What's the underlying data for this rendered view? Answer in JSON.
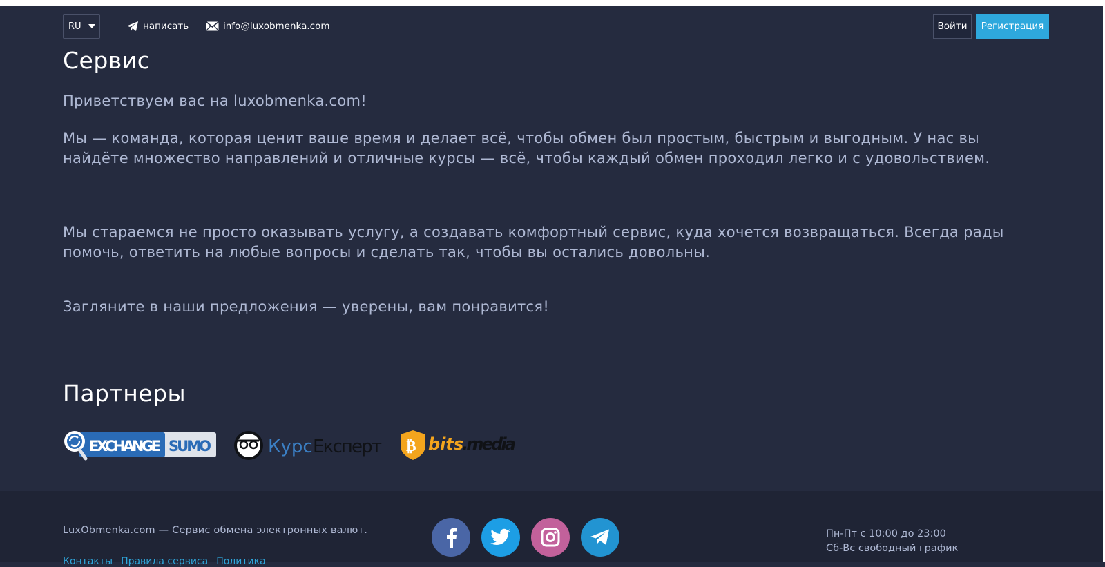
{
  "header": {
    "language": "RU",
    "write_label": "написать",
    "email": "info@luxobmenka.com",
    "login_label": "Войти",
    "register_label": "Регистрация"
  },
  "service": {
    "title": "Сервис",
    "paragraphs": [
      "Приветствуем вас на luxobmenka.com!",
      "Мы — команда, которая ценит ваше время и делает всё, чтобы обмен был простым, быстрым и выгодным. У нас вы найдёте множество направлений и отличные курсы — всё, чтобы каждый обмен проходил легко и с удовольствием.",
      "Мы стараемся не просто оказывать услугу, а создавать комфортный сервис, куда хочется возвращаться. Всегда рады помочь, ответить на любые вопросы и сделать так, чтобы вы остались довольны.",
      "Загляните в наши предложения — уверены, вам понравится!"
    ]
  },
  "partners": {
    "title": "Партнеры",
    "items": [
      {
        "name": "exchangesumo",
        "text_a": "EXCHANGE",
        "text_b": "SUMO"
      },
      {
        "name": "kursexpert",
        "text_a": "Курс",
        "text_b": "Експерт"
      },
      {
        "name": "bitsmedia",
        "text_a": "bits",
        "text_b": ".media"
      }
    ]
  },
  "footer": {
    "description": "LuxObmenka.com — Сервис обмена электронных валют.",
    "links": [
      "Контакты",
      "Правила сервиса",
      "Политика"
    ],
    "schedule_line1": "Пн-Пт с 10:00 до 23:00",
    "schedule_line2": "Сб-Вс свободный график",
    "social": [
      "facebook-icon",
      "twitter-icon",
      "instagram-icon",
      "telegram-icon"
    ]
  },
  "colors": {
    "background": "#252b3f",
    "footer_bg": "#1f2435",
    "accent": "#2ea8dd",
    "text_muted": "#aeb8d3"
  }
}
